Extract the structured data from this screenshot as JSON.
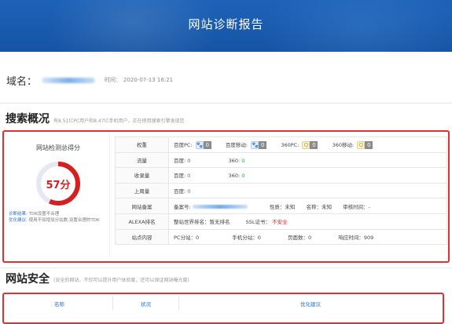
{
  "header": {
    "title": "网站诊断报告"
  },
  "domain": {
    "label": "域名：",
    "time_label": "时间：",
    "time_value": "2020-07-13 16:21"
  },
  "search_overview": {
    "title": "搜索概况",
    "subtitle": "有8.51亿PC用户和8.47亿手机用户，正在使用搜索引擎发现您",
    "score_title": "网站检测总得分",
    "score_text": "57分",
    "score_value": 57,
    "diag": [
      {
        "key": "诊断结果:",
        "text": " TDK设置不合理"
      },
      {
        "key": "优化建议:",
        "text": " 使用不如增加分站数,设置合理的TDK"
      }
    ],
    "rows": {
      "weight": {
        "name": "权重",
        "baidu_pc": "百度PC:",
        "baidu_pc_val": "0",
        "baidu_m": "百度移动:",
        "baidu_m_val": "0",
        "q360_pc": "360PC:",
        "q360_pc_val": "0",
        "q360_m": "360移动:",
        "q360_m_val": "0"
      },
      "traffic": {
        "name": "流量",
        "baidu": "百度:",
        "baidu_val": "0",
        "q360": "360:",
        "q360_val": "0"
      },
      "indexed": {
        "name": "收录量",
        "baidu": "百度:",
        "baidu_val": "0",
        "q360": "360:",
        "q360_val": "0"
      },
      "backlink": {
        "name": "上周量",
        "baidu": "百度:",
        "baidu_val": "0"
      },
      "icp": {
        "name": "网站备案",
        "num": "备案号:",
        "nature": "性质：未知",
        "company": "名称：未知",
        "audit": "审核时间：-"
      },
      "alexa": {
        "name": "ALEXA排名",
        "world": "整站世界排名：暂无排名",
        "ssl_label": "SSL证书：",
        "ssl_val": "不安全"
      },
      "content": {
        "name": "站点内容",
        "pc": "PC分站：0",
        "mobile": "手机分站：0",
        "pages": "页面数：0",
        "response": "响应时间：909"
      }
    }
  },
  "security": {
    "title": "网站安全",
    "subtitle": "(安全的网站，不仅可以提升用户体验度，还可以保证网站曝光度)",
    "headers": [
      "名称",
      "状况",
      "优化建议"
    ]
  },
  "colors": {
    "header_blue": "#1d62b8",
    "alert_red": "#e03030",
    "score_red": "#d42020",
    "link_blue": "#2a6fd0"
  }
}
